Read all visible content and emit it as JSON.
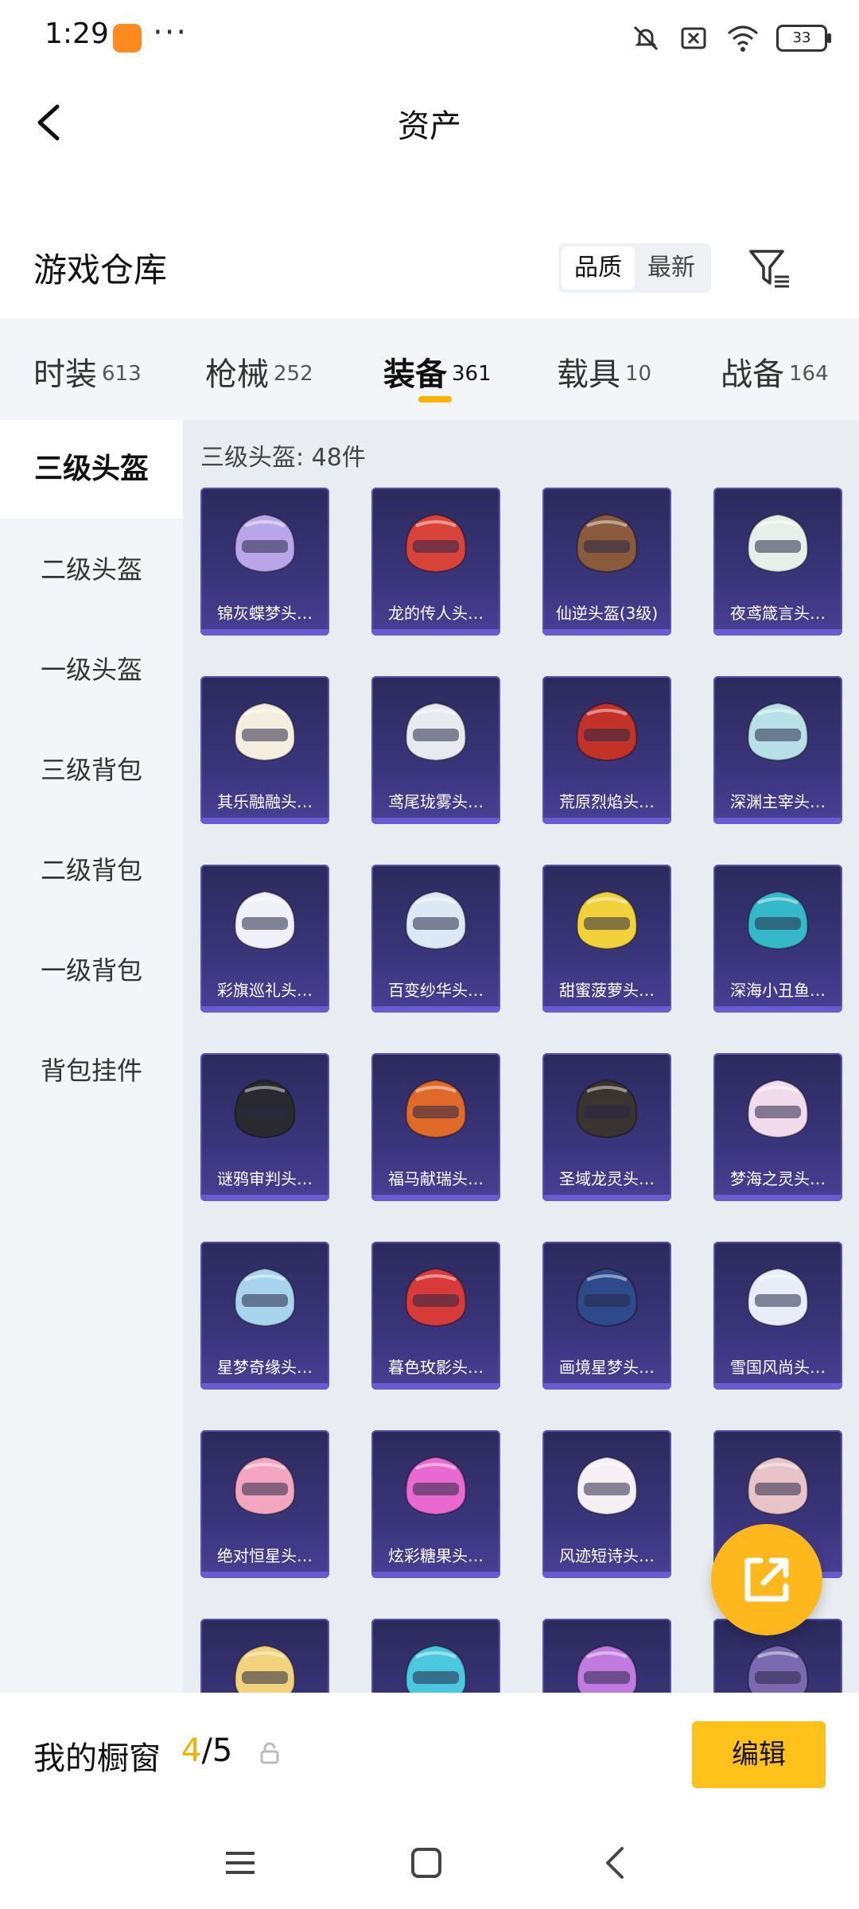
{
  "status": {
    "time": "1:29",
    "dots": "···",
    "battery": "33"
  },
  "header": {
    "title": "资产"
  },
  "warehouse": {
    "title": "游戏仓库",
    "sort_options": [
      "品质",
      "最新"
    ]
  },
  "tabs": [
    {
      "label": "时装",
      "count": "613"
    },
    {
      "label": "枪械",
      "count": "252"
    },
    {
      "label": "装备",
      "count": "361"
    },
    {
      "label": "载具",
      "count": "10"
    },
    {
      "label": "战备",
      "count": "164"
    }
  ],
  "sidebar": {
    "items": [
      "三级头盔",
      "二级头盔",
      "一级头盔",
      "三级背包",
      "二级背包",
      "一级背包",
      "背包挂件"
    ]
  },
  "content": {
    "count_label": "三级头盔: 48件",
    "items": [
      {
        "name": "锦灰蝶梦头…",
        "color": "#b9a6e8"
      },
      {
        "name": "龙的传人头…",
        "color": "#d8443a"
      },
      {
        "name": "仙逆头盔(3级)",
        "color": "#8a5a3c"
      },
      {
        "name": "夜鸢箴言头…",
        "color": "#e6f0e8"
      },
      {
        "name": "其乐融融头…",
        "color": "#f4eee0"
      },
      {
        "name": "鸢尾珑雾头…",
        "color": "#e8eaf0"
      },
      {
        "name": "荒原烈焰头…",
        "color": "#c23228"
      },
      {
        "name": "深渊主宰头…",
        "color": "#b8e0e6"
      },
      {
        "name": "彩旗巡礼头…",
        "color": "#f0f0f8"
      },
      {
        "name": "百变纱华头…",
        "color": "#dce8f4"
      },
      {
        "name": "甜蜜菠萝头…",
        "color": "#f2d23a"
      },
      {
        "name": "深海小丑鱼…",
        "color": "#35b8c8"
      },
      {
        "name": "谜鸦审判头…",
        "color": "#2a2a2e"
      },
      {
        "name": "福马献瑞头…",
        "color": "#e06a2a"
      },
      {
        "name": "圣域龙灵头…",
        "color": "#3a3430"
      },
      {
        "name": "梦海之灵头…",
        "color": "#f0dcec"
      },
      {
        "name": "星梦奇缘头…",
        "color": "#a8d4ee"
      },
      {
        "name": "暮色玫影头…",
        "color": "#d83a3a"
      },
      {
        "name": "画境星梦头…",
        "color": "#2e4a8a"
      },
      {
        "name": "雪国风尚头…",
        "color": "#e8eef8"
      },
      {
        "name": "绝对恒星头…",
        "color": "#f4a6c0"
      },
      {
        "name": "炫彩糖果头…",
        "color": "#e86ad0"
      },
      {
        "name": "风迹短诗头…",
        "color": "#f4f0f4"
      },
      {
        "name": "",
        "color": "#e8c4c8"
      },
      {
        "name": "",
        "color": "#f2d27a"
      },
      {
        "name": "",
        "color": "#4ac8e0"
      },
      {
        "name": "",
        "color": "#c07ae0"
      },
      {
        "name": "",
        "color": "#7a6ab0"
      }
    ]
  },
  "showcase": {
    "label": "我的橱窗",
    "current": "4",
    "total": "/5",
    "edit_label": "编辑"
  }
}
